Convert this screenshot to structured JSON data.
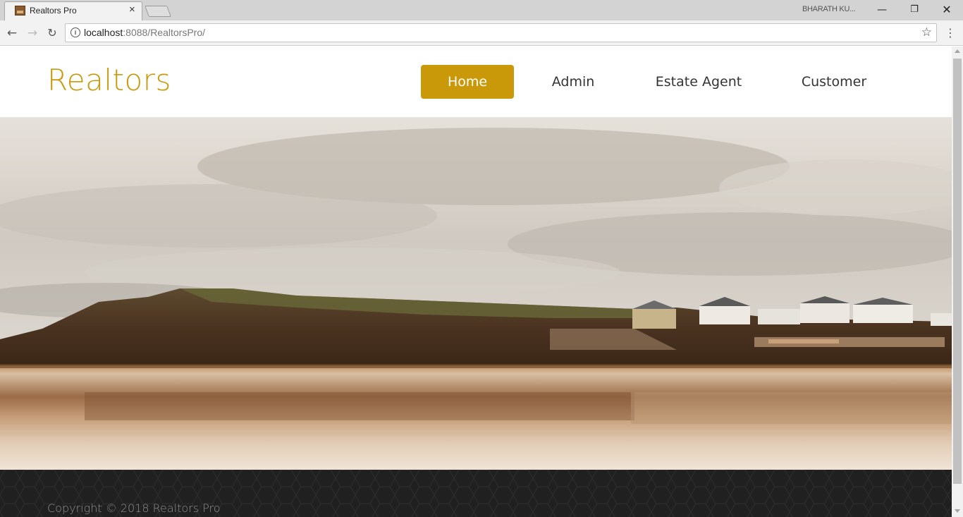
{
  "browser": {
    "tab_title": "Realtors Pro",
    "tab_close": "×",
    "profile_name": "BHARATH KU...",
    "url_host": "localhost",
    "url_rest": ":8088/RealtorsPro/",
    "icons": {
      "back": "back-arrow-icon",
      "forward": "forward-arrow-icon",
      "reload": "reload-icon",
      "info": "info-icon",
      "star": "bookmark-star-icon",
      "menu": "kebab-menu-icon"
    }
  },
  "site": {
    "logo": "Realtors",
    "nav": {
      "home": "Home",
      "admin": "Admin",
      "agent": "Estate Agent",
      "customer": "Customer"
    },
    "active_nav": "home",
    "footer_text": "Copyright © 2018 Realtors Pro"
  },
  "colors": {
    "brand": "#c9990a",
    "footer_bg": "#202020"
  }
}
